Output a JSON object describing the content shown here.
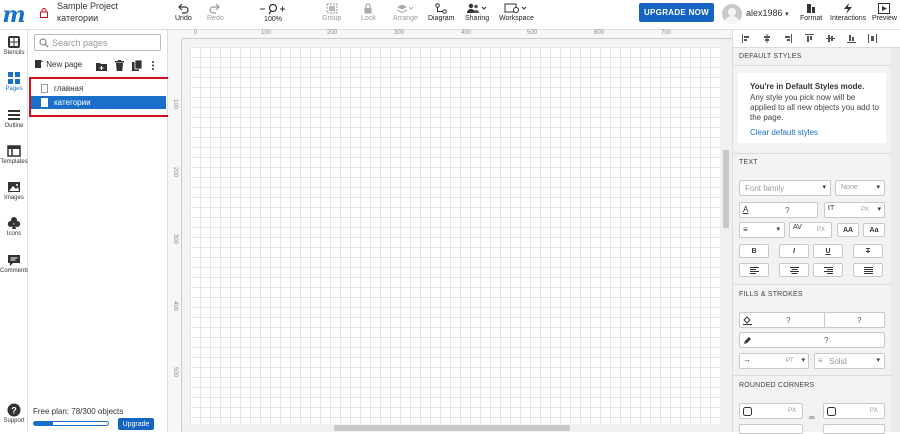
{
  "project": {
    "title": "Sample Project",
    "current_page": "категории"
  },
  "toolbar": {
    "undo": "Undo",
    "redo": "Redo",
    "zoom": "100%",
    "group": "Group",
    "lock": "Lock",
    "arrange": "Arrange",
    "diagram": "Diagram",
    "sharing": "Sharing",
    "workspace": "Workspace",
    "upgrade": "UPGRADE NOW",
    "username": "alex1986",
    "format": "Format",
    "interactions": "Interactions",
    "preview": "Preview"
  },
  "left_rail": {
    "stencils": "Stencils",
    "pages": "Pages",
    "outline": "Outline",
    "templates": "Templates",
    "images": "Images",
    "icons": "Icons",
    "comments": "Comments",
    "support": "Support"
  },
  "pages_panel": {
    "search_placeholder": "Search pages",
    "new_page": "New page",
    "pages": [
      {
        "label": "главная"
      },
      {
        "label": "категории"
      }
    ],
    "free_plan": "Free plan: 78/300 objects",
    "upgrade": "Upgrade",
    "usage_fraction": 0.26
  },
  "rulers": {
    "h": [
      "0",
      "100",
      "200",
      "300",
      "400",
      "500",
      "600",
      "700"
    ],
    "v": [
      "100",
      "200",
      "300",
      "400",
      "500"
    ]
  },
  "right_panel": {
    "default_styles": "DEFAULT STYLES",
    "info_title": "You're in Default Styles mode.",
    "info_text": "Any style you pick now will be applied to all new objects you add to the page.",
    "info_link": "Clear default styles",
    "text_section": "TEXT",
    "font_family": "Font family",
    "font_none": "None",
    "q": "?",
    "px": "PX",
    "aa_upper": "AA",
    "aa_mixed": "Aa",
    "bold": "B",
    "italic": "I",
    "underline": "U",
    "strike": "T",
    "fills_section": "FILLS & STROKES",
    "pt": "PT",
    "solid": "Solid",
    "rounded_section": "ROUNDED CORNERS"
  },
  "colors": {
    "accent": "#1a6fc9",
    "upgrade": "#1565c0",
    "highlight": "#d0101b"
  }
}
